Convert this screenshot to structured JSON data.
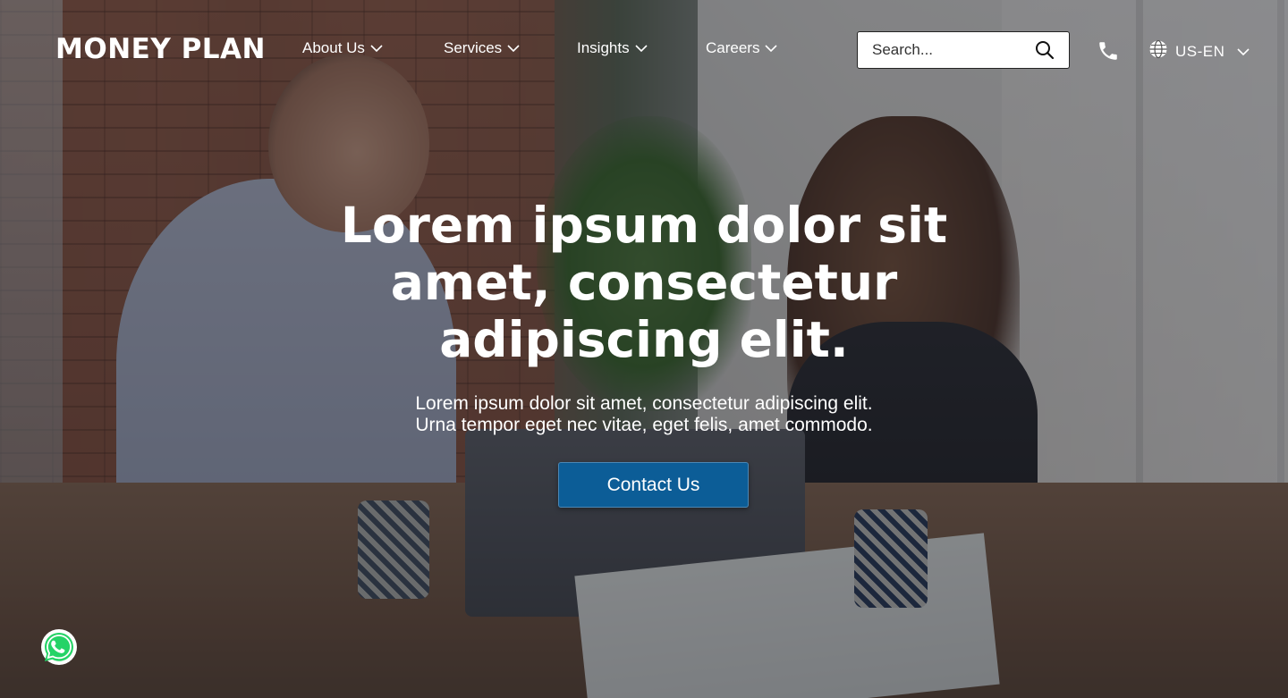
{
  "brand": {
    "logo_text": "MONEY PLAN"
  },
  "nav": {
    "items": [
      {
        "label": "About Us"
      },
      {
        "label": "Services"
      },
      {
        "label": "Insights"
      },
      {
        "label": "Careers"
      }
    ]
  },
  "search": {
    "placeholder": "Search..."
  },
  "language": {
    "label": "US-EN"
  },
  "hero": {
    "title_line1": "Lorem ipsum dolor sit",
    "title_line2": "amet, consectetur",
    "title_line3": "adipiscing elit.",
    "subtitle_line1": "Lorem ipsum dolor sit amet, consectetur adipiscing elit.",
    "subtitle_line2": "Urna tempor eget nec vitae, eget felis, amet commodo.",
    "cta_label": "Contact Us"
  },
  "colors": {
    "cta_background": "#0c5d97",
    "overlay": "#14161f",
    "whatsapp_green": "#25d366"
  },
  "icons": [
    "chevron-down-icon",
    "search-icon",
    "phone-icon",
    "globe-icon",
    "whatsapp-icon"
  ]
}
